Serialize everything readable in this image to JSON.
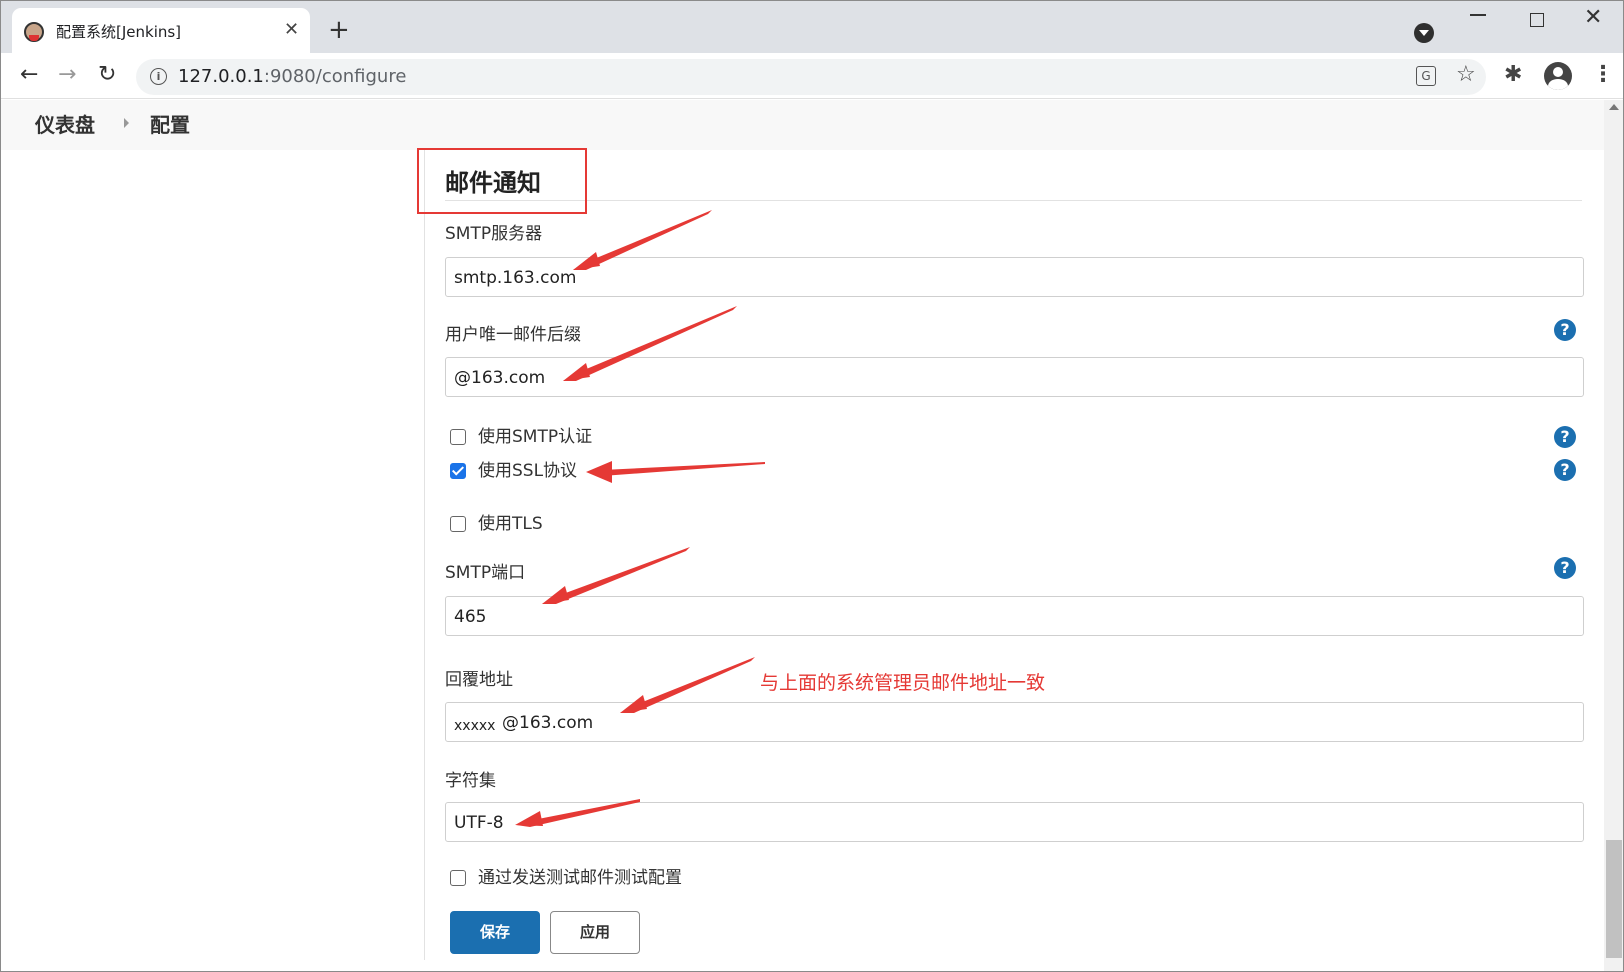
{
  "browser": {
    "tab_title": "配置系统[Jenkins]",
    "tab_close": "✕",
    "new_tab": "+",
    "back": "←",
    "forward": "→",
    "reload": "↻",
    "url_host": "127.0.0.1",
    "url_path": ":9080/configure",
    "star": "☆",
    "extensions": "✱",
    "menu": "⋮",
    "win_close": "✕",
    "info_icon": "i",
    "translate_icon": "G",
    "icons": [
      "back-icon",
      "forward-icon",
      "reload-icon",
      "info-icon",
      "translate-icon",
      "star-icon",
      "puzzle-icon",
      "avatar-icon",
      "kebab-menu-icon"
    ]
  },
  "breadcrumb": {
    "dashboard": "仪表盘",
    "configure": "配置"
  },
  "section": {
    "title": "邮件通知"
  },
  "smtp_server": {
    "label": "SMTP服务器",
    "value": "smtp.163.com"
  },
  "email_suffix": {
    "label": "用户唯一邮件后缀",
    "value": "@163.com"
  },
  "options": {
    "smtp_auth": {
      "label": "使用SMTP认证",
      "checked": false
    },
    "use_ssl": {
      "label": "使用SSL协议",
      "checked": true
    },
    "use_tls": {
      "label": "使用TLS",
      "checked": false
    }
  },
  "smtp_port": {
    "label": "SMTP端口",
    "value": "465"
  },
  "reply_to": {
    "label": "回覆地址",
    "value_masked": "xxxxx",
    "value_domain": "@163.com"
  },
  "charset": {
    "label": "字符集",
    "value": "UTF-8"
  },
  "test_config": {
    "label": "通过发送测试邮件测试配置",
    "checked": false
  },
  "help_icon": "?",
  "annotation": {
    "note": "与上面的系统管理员邮件地址一致",
    "color": "#e53935"
  },
  "buttons": {
    "save": "保存",
    "apply": "应用"
  },
  "colors": {
    "primary": "#1b6fb0",
    "annotation_red": "#e53935",
    "checkbox_blue": "#1a73e8"
  }
}
